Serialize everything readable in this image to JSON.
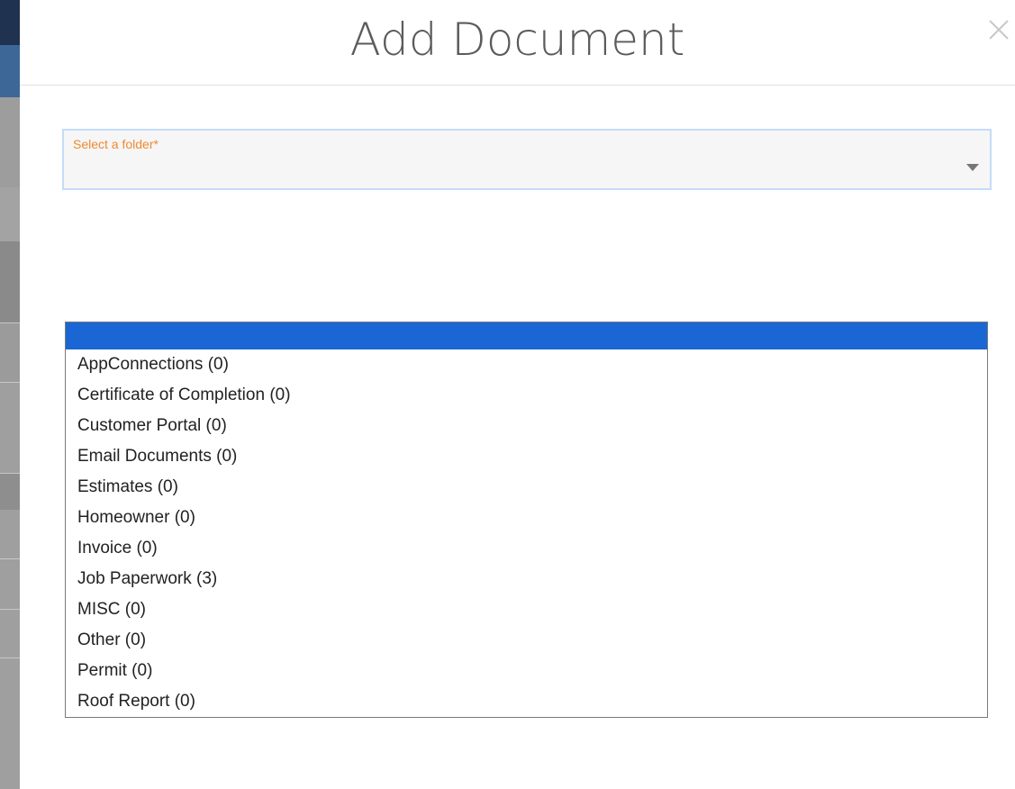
{
  "modal": {
    "title": "Add Document"
  },
  "folder_select": {
    "label": "Select a folder*",
    "selected_value": ""
  },
  "folder_options": [
    {
      "label": ""
    },
    {
      "label": "AppConnections (0)"
    },
    {
      "label": "Certificate of Completion (0)"
    },
    {
      "label": "Customer Portal (0)"
    },
    {
      "label": "Email Documents (0)"
    },
    {
      "label": "Estimates (0)"
    },
    {
      "label": "Homeowner (0)"
    },
    {
      "label": "Invoice (0)"
    },
    {
      "label": "Job Paperwork (3)"
    },
    {
      "label": "MISC (0)"
    },
    {
      "label": "Other (0)"
    },
    {
      "label": "Permit (0)"
    },
    {
      "label": "Roof Report (0)"
    }
  ],
  "colors": {
    "label_accent": "#ef8a2e",
    "option_highlight": "#1a66d4",
    "field_border_focus": "#c4dcfa"
  },
  "icons": {
    "close": "close-icon",
    "dropdown": "chevron-down-icon"
  }
}
